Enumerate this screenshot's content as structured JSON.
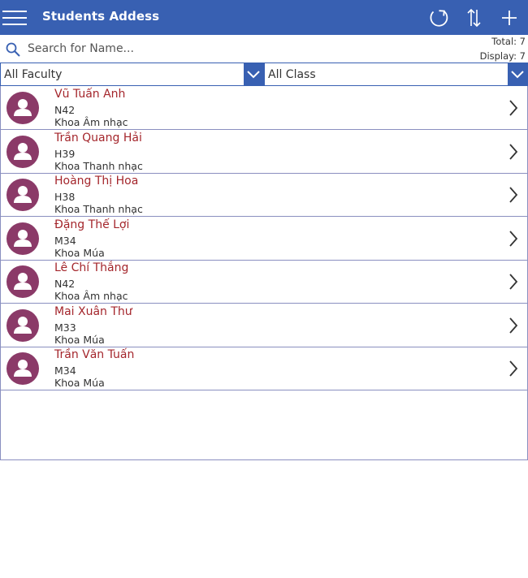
{
  "header": {
    "title": "Students Addess",
    "icons": [
      "hamburger-icon",
      "refresh-icon",
      "sort-icon",
      "add-icon"
    ],
    "color": "#3860b2"
  },
  "search": {
    "placeholder": "Search for Name...",
    "total_label": "Total: 7",
    "display_label": "Display: 7"
  },
  "filters": {
    "faculty": "All Faculty",
    "class": "All Class"
  },
  "students": [
    {
      "name": "Vũ Tuấn Anh",
      "class": "N42",
      "faculty": "Khoa Âm nhạc"
    },
    {
      "name": "Trần Quang Hải",
      "class": "H39",
      "faculty": "Khoa Thanh nhạc"
    },
    {
      "name": "Hoàng Thị Hoa",
      "class": "H38",
      "faculty": "Khoa Thanh nhạc"
    },
    {
      "name": "Đặng Thế Lợi",
      "class": "M34",
      "faculty": "Khoa Múa"
    },
    {
      "name": "Lê Chí Thắng",
      "class": "N42",
      "faculty": "Khoa Âm nhạc"
    },
    {
      "name": "Mai Xuân Thư",
      "class": "M33",
      "faculty": "Khoa Múa"
    },
    {
      "name": "Trần Văn Tuấn",
      "class": "M34",
      "faculty": "Khoa Múa"
    }
  ],
  "colors": {
    "accent": "#3860b2",
    "name": "#a4262c",
    "avatar": "#8b3a68",
    "divider": "#8a8fc0"
  }
}
